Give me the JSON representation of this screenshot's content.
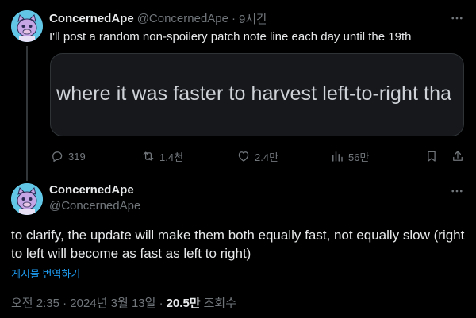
{
  "tweet1": {
    "name": "ConcernedApe",
    "handle": "@ConcernedApe",
    "separator": "·",
    "time": "9시간",
    "text": "I'll post a random non-spoilery patch note line each day until the 19th",
    "media_text": "ug where it was faster to harvest left-to-right tha",
    "stats": {
      "replies": "319",
      "reposts": "1.4천",
      "likes": "2.4만",
      "views": "56만"
    }
  },
  "tweet2": {
    "name": "ConcernedApe",
    "handle": "@ConcernedApe",
    "text": "to clarify, the update will make them both equally fast, not equally slow (right to left will become as fast as left to right)",
    "translate_label": "게시물 번역하기",
    "timestamp": "오전 2:35 · 2024년 3월 13일 ·",
    "views_count": "20.5만",
    "views_label": "조회수"
  },
  "colors": {
    "background": "#000000",
    "text": "#e7e9ea",
    "muted": "#71767b",
    "link": "#1d9bf0",
    "avatar": "#62c7e6"
  }
}
